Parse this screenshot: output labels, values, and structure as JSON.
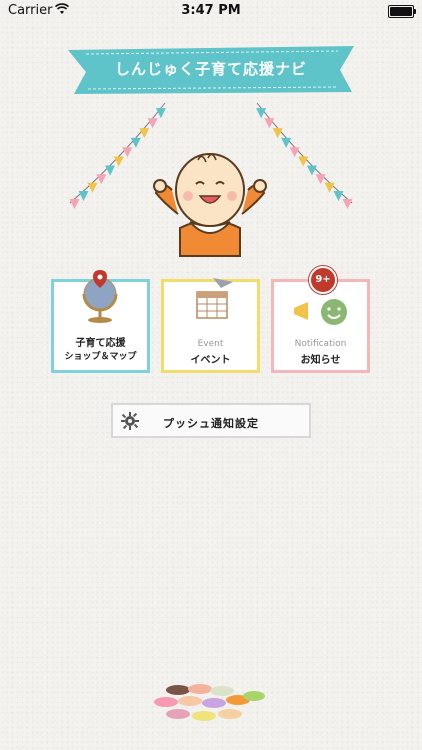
{
  "status_bar": {
    "carrier": "Carrier",
    "time": "3:47 PM",
    "wifi_icon": "wifi-icon",
    "battery_icon": "battery-icon"
  },
  "header": {
    "title": "しんじゅく子育て応援ナビ",
    "banner_color": "#5ec4c9"
  },
  "tiles": {
    "shop": {
      "label_line1": "子育て応援",
      "label_line2": "ショップ＆マップ",
      "icon": "globe-map-pin-icon",
      "border_color": "#7fd2dc"
    },
    "event": {
      "sub_label": "Event",
      "label": "イベント",
      "icon": "calendar-icon",
      "border_color": "#f1dd6a"
    },
    "notification": {
      "sub_label": "Notification",
      "label": "お知らせ",
      "icon": "smiley-megaphone-icon",
      "border_color": "#f2b8b8",
      "badge": "9+"
    }
  },
  "push_settings": {
    "label": "プッシュ通知設定",
    "icon": "gear-icon"
  },
  "decorations": {
    "mascot": "baby-mascot",
    "bottom": "macarons"
  }
}
